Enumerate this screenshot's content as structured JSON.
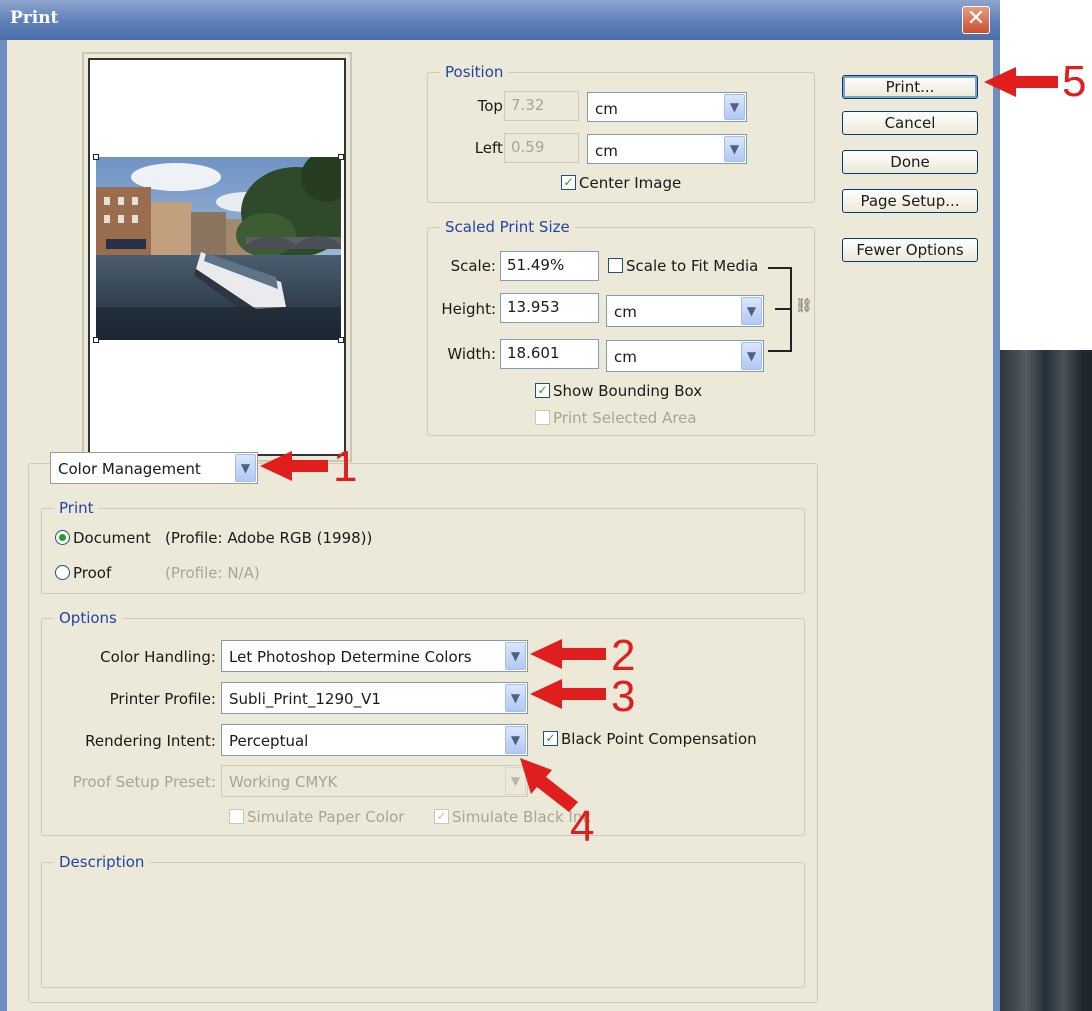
{
  "window": {
    "title": "Print",
    "close": "✕"
  },
  "position": {
    "legend": "Position",
    "top_label": "Top:",
    "top_value": "7.32",
    "top_unit": "cm",
    "left_label": "Left:",
    "left_value": "0.59",
    "left_unit": "cm",
    "center_image": "Center Image",
    "center_checked": true
  },
  "scaled": {
    "legend": "Scaled Print Size",
    "scale_label": "Scale:",
    "scale_value": "51.49%",
    "fit_media": "Scale to Fit Media",
    "fit_checked": false,
    "height_label": "Height:",
    "height_value": "13.953",
    "height_unit": "cm",
    "width_label": "Width:",
    "width_value": "18.601",
    "width_unit": "cm",
    "bounding_box": "Show Bounding Box",
    "bounding_checked": true,
    "selected_area": "Print Selected Area",
    "selected_checked": false
  },
  "buttons": {
    "print": "Print...",
    "cancel": "Cancel",
    "done": "Done",
    "page_setup": "Page Setup...",
    "fewer_options": "Fewer Options"
  },
  "mode_select": {
    "value": "Color Management"
  },
  "print_group": {
    "legend": "Print",
    "document_label": "Document",
    "document_profile": "(Profile: Adobe RGB (1998))",
    "document_selected": true,
    "proof_label": "Proof",
    "proof_profile": "(Profile: N/A)",
    "proof_selected": false
  },
  "options": {
    "legend": "Options",
    "color_handling_label": "Color Handling:",
    "color_handling_value": "Let Photoshop Determine Colors",
    "printer_profile_label": "Printer Profile:",
    "printer_profile_value": "Subli_Print_1290_V1",
    "rendering_intent_label": "Rendering Intent:",
    "rendering_intent_value": "Perceptual",
    "bpc_label": "Black Point Compensation",
    "bpc_checked": true,
    "proof_setup_label": "Proof Setup Preset:",
    "proof_setup_value": "Working CMYK",
    "simulate_paper": "Simulate Paper Color",
    "simulate_paper_checked": false,
    "simulate_black": "Simulate Black Ink",
    "simulate_black_checked": true
  },
  "description": {
    "legend": "Description"
  },
  "annotations": [
    "1",
    "2",
    "3",
    "4",
    "5"
  ],
  "colors": {
    "annotation_red": "#e01e1e",
    "legend_blue": "#2244aa",
    "dialog_bg": "#ece9d8"
  }
}
